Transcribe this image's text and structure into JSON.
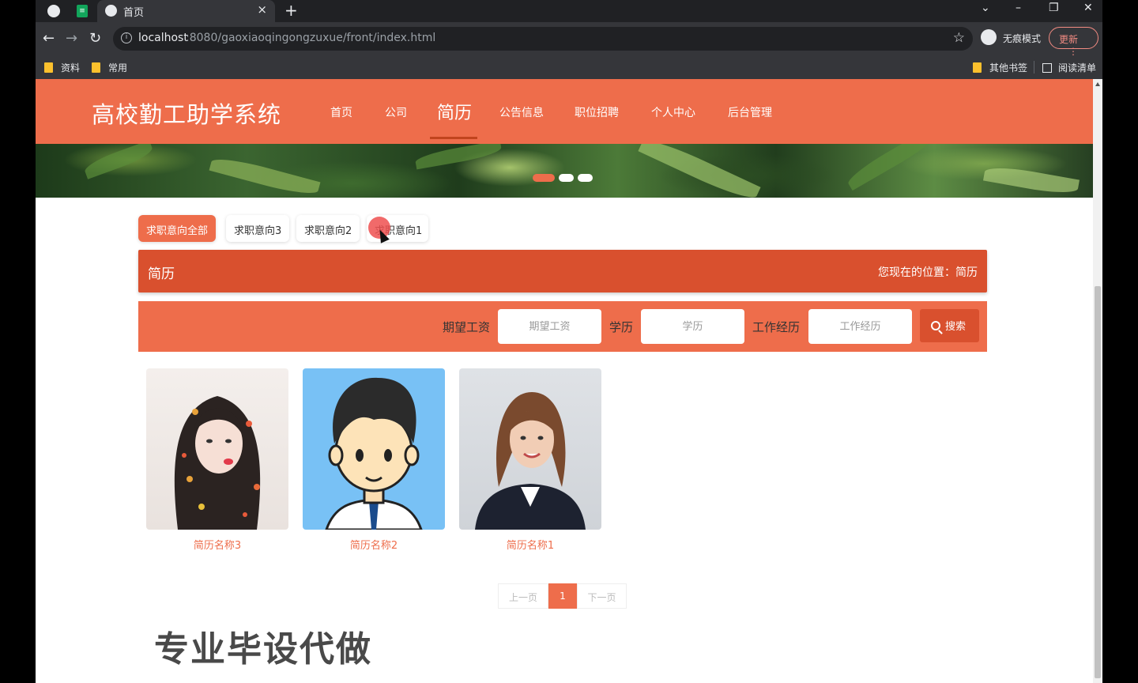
{
  "browser": {
    "tab_title": "首页",
    "tab_close": "×",
    "new_tab": "+",
    "url_host": "localhost",
    "url_path": ":8080/gaoxiaoqingongzuxue/front/index.html",
    "incognito_label": "无痕模式",
    "update_label": "更新",
    "update_menu": "⋮",
    "back": "←",
    "forward": "→",
    "reload": "↻",
    "star": "☆",
    "info": "i",
    "window_controls": [
      "⌄",
      "–",
      "❐",
      "✕"
    ],
    "bookmarks": [
      "资料",
      "常用"
    ],
    "other_bookmarks": "其他书签",
    "reading_list": "阅读清单"
  },
  "site": {
    "logo": "高校勤工助学系统",
    "nav": [
      "首页",
      "公司",
      "简历",
      "公告信息",
      "职位招聘",
      "个人中心",
      "后台管理"
    ],
    "active_nav": "简历"
  },
  "filters": [
    "求职意向全部",
    "求职意向3",
    "求职意向2",
    "求职意向1"
  ],
  "title_bar": {
    "left": "简历",
    "right": "您现在的位置：简历"
  },
  "search": {
    "label_salary": "期望工资",
    "placeholder_salary": "期望工资",
    "label_edu": "学历",
    "placeholder_edu": "学历",
    "label_exp": "工作经历",
    "placeholder_exp": "工作经历",
    "button": "搜索"
  },
  "cards": [
    {
      "name": "简历名称3"
    },
    {
      "name": "简历名称2"
    },
    {
      "name": "简历名称1"
    }
  ],
  "pager": {
    "prev": "上一页",
    "current": "1",
    "next": "下一页"
  },
  "watermark": "专业毕设代做",
  "colors": {
    "primary": "#ee6d4b",
    "primary_dark": "#d9502e"
  }
}
